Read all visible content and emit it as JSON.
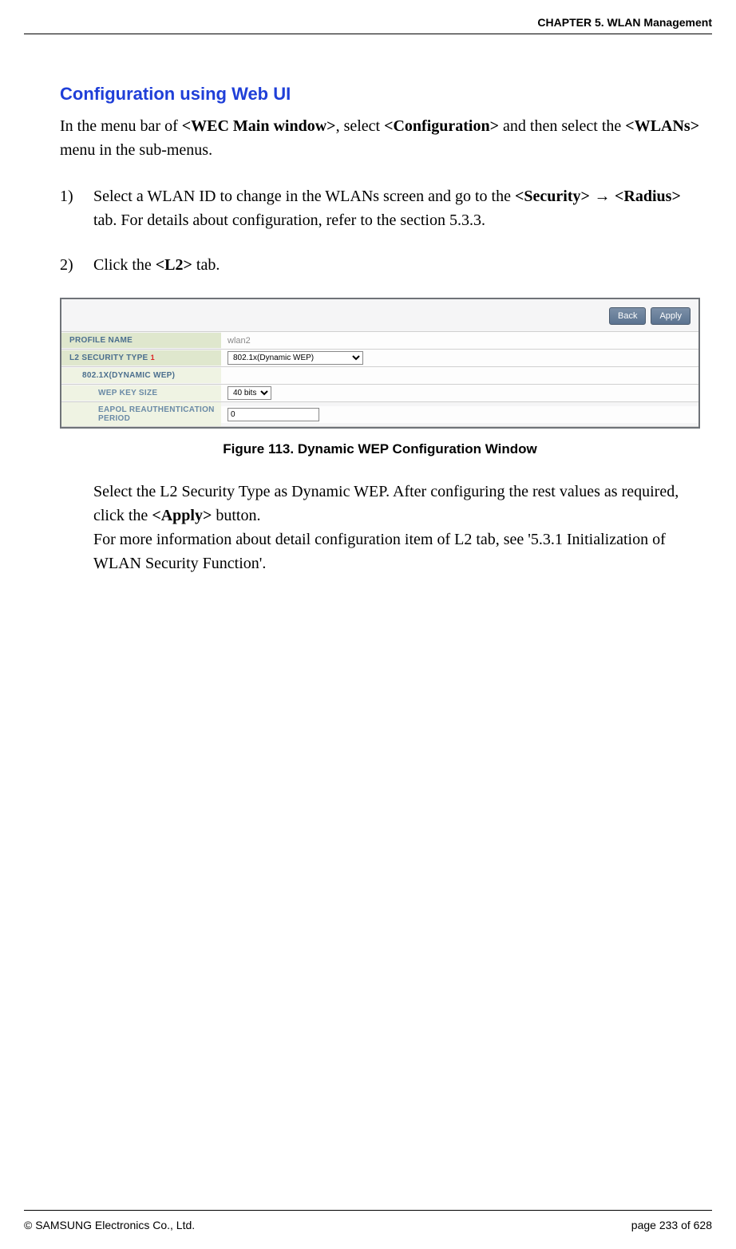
{
  "header": {
    "chapter": "CHAPTER 5. WLAN Management"
  },
  "section": {
    "title": "Configuration using Web UI",
    "intro_pre": "In the menu bar of ",
    "intro_b1": "<WEC Main window>",
    "intro_mid": ", select ",
    "intro_b2": "<Configuration>",
    "intro_mid2": " and then select the ",
    "intro_b3": "<WLANs>",
    "intro_post": " menu in the sub-menus."
  },
  "steps": {
    "s1_num": "1)",
    "s1_a": "Select a WLAN ID to change in the WLANs screen and go to the ",
    "s1_b1": "<Security>",
    "s1_arrow": " → ",
    "s1_b2": "<Radius>",
    "s1_c": " tab. For details about configuration, refer to the section 5.3.3.",
    "s2_num": "2)",
    "s2_a": "Click the ",
    "s2_b1": "<L2>",
    "s2_c": " tab."
  },
  "screenshot": {
    "back_btn": "Back",
    "apply_btn": "Apply",
    "row1_label": "PROFILE NAME",
    "row1_value": "wlan2",
    "row2_label": "L2 SECURITY TYPE",
    "row2_req": "1",
    "row2_value": "802.1x(Dynamic WEP)",
    "row3_label": "802.1X(DYNAMIC WEP)",
    "row4_label": "WEP KEY SIZE",
    "row4_value": "40 bits",
    "row5_label": "EAPOL REAUTHENTICATION PERIOD",
    "row5_value": "0"
  },
  "figure": {
    "caption": "Figure 113. Dynamic WEP Configuration Window"
  },
  "post": {
    "p1_a": "Select the L2 Security Type as Dynamic WEP. After configuring the rest values as required, click the ",
    "p1_b": "<Apply>",
    "p1_c": " button.",
    "p2": "For more information about detail configuration item of L2 tab, see '5.3.1 Initialization of WLAN Security Function'."
  },
  "footer": {
    "copyright": "© SAMSUNG Electronics Co., Ltd.",
    "page": "page 233 of 628"
  }
}
